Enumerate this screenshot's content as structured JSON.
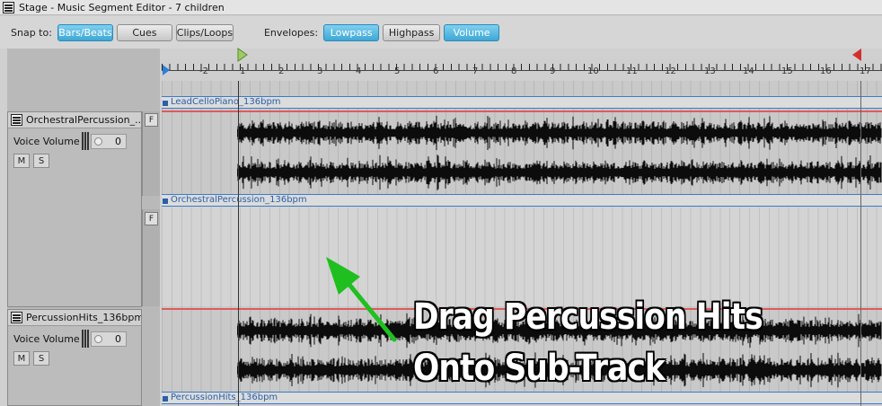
{
  "window": {
    "title": "Stage - Music Segment Editor - 7 children"
  },
  "toolbar": {
    "snap_label": "Snap to:",
    "snap_options": [
      {
        "label": "Bars/Beats",
        "active": true
      },
      {
        "label": "Cues",
        "active": false
      },
      {
        "label": "Clips/Loops",
        "active": false
      }
    ],
    "envelopes_label": "Envelopes:",
    "envelope_options": [
      {
        "label": "Lowpass",
        "active": true
      },
      {
        "label": "Highpass",
        "active": false
      },
      {
        "label": "Volume",
        "active": true
      }
    ]
  },
  "ruler": {
    "marks": [
      "-2",
      "1",
      "2",
      "3",
      "4",
      "5",
      "6",
      "7",
      "8",
      "9",
      "10",
      "11",
      "12",
      "13",
      "14",
      "15",
      "16",
      "17"
    ]
  },
  "tracks": [
    {
      "name": "OrchestralPercussion_...",
      "voice_volume_label": "Voice Volume",
      "volume_value": "0",
      "mute": "M",
      "solo": "S",
      "filter_button": "F"
    },
    {
      "name": "PercussionHits_136bpm",
      "voice_volume_label": "Voice Volume",
      "volume_value": "0",
      "mute": "M",
      "solo": "S"
    }
  ],
  "subtrack": {
    "filter_button": "F"
  },
  "regions": [
    {
      "label": "LeadCelloPiano_136bpm"
    },
    {
      "label": "OrchestralPercussion_136bpm"
    },
    {
      "label": "PercussionHits_136bpm"
    }
  ],
  "annotation": {
    "line1": "Drag Percussion Hits",
    "line2": "Onto Sub-Track",
    "arrow_color": "#1fbf1f"
  },
  "colors": {
    "accent_active": "#3ea7d6",
    "region_border": "#3a7cc7",
    "track_redline": "#e05a5a",
    "flag_green": "#9ccc65",
    "flag_red": "#d32f2f",
    "marker_blue": "#2e7fd6"
  }
}
